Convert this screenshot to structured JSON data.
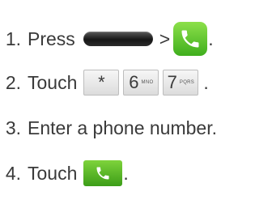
{
  "steps": [
    {
      "number": "1.",
      "text": "Press",
      "separator": ">",
      "end": ".",
      "icons": [
        "home-key-icon",
        "phone-app-icon"
      ]
    },
    {
      "number": "2.",
      "text": "Touch",
      "end": ".",
      "keys": [
        {
          "main": "*",
          "sub": ""
        },
        {
          "main": "6",
          "sub": "MNO"
        },
        {
          "main": "7",
          "sub": "PQRS"
        }
      ]
    },
    {
      "number": "3.",
      "text": "Enter a phone number."
    },
    {
      "number": "4.",
      "text": "Touch",
      "end": ".",
      "icons": [
        "call-button-icon"
      ]
    }
  ],
  "colors": {
    "text": "#3a3a3a",
    "phone_green": "#4fbf26",
    "home_key": "#1e1e1e",
    "key_border": "#bdbdbd"
  }
}
